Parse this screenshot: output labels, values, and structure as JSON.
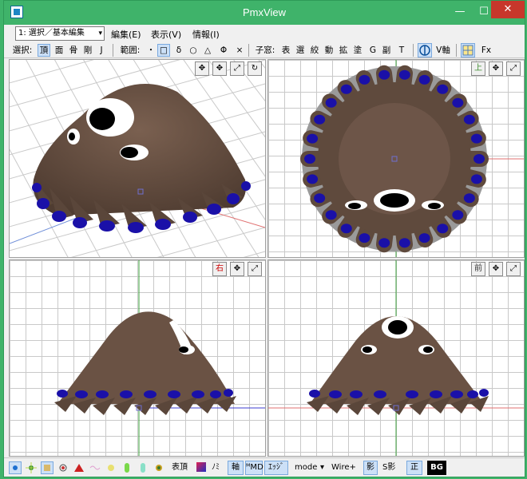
{
  "window": {
    "title": "PmxView"
  },
  "menubar": {
    "mode_select": "1: 選択／基本編集",
    "items": [
      "編集(E)",
      "表示(V)",
      "情報(I)"
    ]
  },
  "toolbar": {
    "select_label": "選択:",
    "select_items": [
      "頂",
      "面",
      "骨",
      "剛",
      "J"
    ],
    "range_label": "範囲:",
    "range_items": [
      "・",
      "□",
      "δ",
      "○",
      "△",
      "Φ",
      "×"
    ],
    "child_label": "子窓:",
    "child_items": [
      "表",
      "選",
      "絞",
      "動",
      "拡",
      "塗",
      "G",
      "副",
      "T"
    ],
    "axis_label": "V軸",
    "fx_label": "Fx"
  },
  "viewports": {
    "top_label": "上",
    "right_label": "右",
    "front_label": "前"
  },
  "statusbar": {
    "vertex_label": "表頂",
    "edge_label": "ﾉﾐ",
    "axis_btn": "軸",
    "md_btn": "ᴹMD",
    "edge_btn": "ｴｯｼﾞ",
    "mode_label": "mode",
    "wire_label": "Wire+",
    "shadow_btn": "影",
    "sshadow_label": "S影",
    "ortho_btn": "正",
    "bg_btn": "BG"
  },
  "colors": {
    "accent": "#3fb36a",
    "body": "#6b5446",
    "nail": "#1a10a8"
  }
}
